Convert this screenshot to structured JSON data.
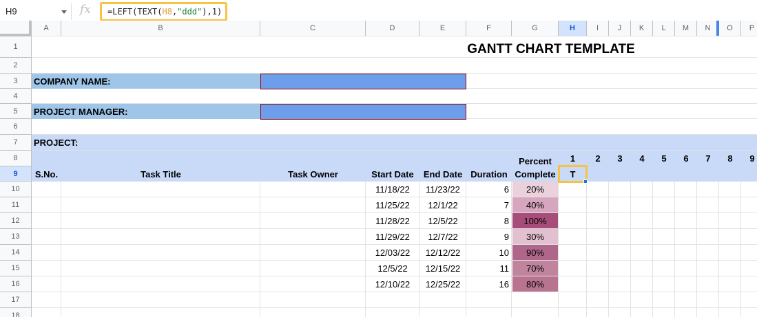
{
  "formula_bar": {
    "name_box": "H9",
    "fx_symbol": "fx",
    "formula_prefix": "=LEFT(TEXT(",
    "formula_ref": "H8",
    "formula_sep": ",",
    "formula_str": "\"ddd\"",
    "formula_suffix": "),1)"
  },
  "columns": [
    "A",
    "B",
    "C",
    "D",
    "E",
    "F",
    "G",
    "H",
    "I",
    "J",
    "K",
    "L",
    "M",
    "N",
    "O",
    "P"
  ],
  "rows": [
    "1",
    "2",
    "3",
    "4",
    "5",
    "6",
    "7",
    "8",
    "9",
    "10",
    "11",
    "12",
    "13",
    "14",
    "15",
    "16",
    "17",
    "18"
  ],
  "sheet": {
    "title": "GANTT CHART TEMPLATE",
    "company_label": "COMPANY NAME:",
    "manager_label": "PROJECT MANAGER:",
    "project_label": "PROJECT:",
    "headers": {
      "sno": "S.No.",
      "task_title": "Task Title",
      "task_owner": "Task Owner",
      "start_date": "Start Date",
      "end_date": "End Date",
      "duration": "Duration",
      "percent_line1": "Percent",
      "percent_line2": "Complete"
    },
    "day_numbers": [
      "1",
      "2",
      "3",
      "4",
      "5",
      "6",
      "7",
      "8",
      "9"
    ],
    "selected_cell_value": "T",
    "tasks": [
      {
        "start": "11/18/22",
        "end": "11/23/22",
        "duration": "6",
        "percent": "20%",
        "color": "#ead1dc"
      },
      {
        "start": "11/25/22",
        "end": "12/1/22",
        "duration": "7",
        "percent": "40%",
        "color": "#d5a6bd"
      },
      {
        "start": "11/28/22",
        "end": "12/5/22",
        "duration": "8",
        "percent": "100%",
        "color": "#a64d79"
      },
      {
        "start": "11/29/22",
        "end": "12/7/22",
        "duration": "9",
        "percent": "30%",
        "color": "#e2c0d0"
      },
      {
        "start": "12/03/22",
        "end": "12/12/22",
        "duration": "10",
        "percent": "90%",
        "color": "#b0668a"
      },
      {
        "start": "12/5/22",
        "end": "12/15/22",
        "duration": "11",
        "percent": "70%",
        "color": "#c1849f"
      },
      {
        "start": "12/10/22",
        "end": "12/25/22",
        "duration": "16",
        "percent": "80%",
        "color": "#b8738f"
      }
    ]
  },
  "colors": {
    "label_bar": "#9fc5e8",
    "input_box": "#6d9eeb",
    "header_fill": "#c9daf8",
    "highlight": "#f6c343"
  }
}
